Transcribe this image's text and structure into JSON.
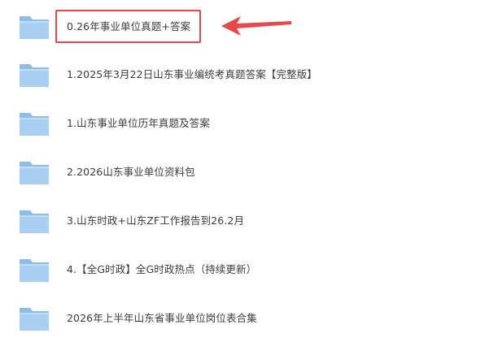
{
  "folders": [
    {
      "name": "0.26年事业单位真题+答案"
    },
    {
      "name": "1.2025年3月22日山东事业编统考真题答案【完整版】"
    },
    {
      "name": "1.山东事业单位历年真题及答案"
    },
    {
      "name": "2.2026山东事业单位资料包"
    },
    {
      "name": "3.山东时政+山东ZF工作报告到26.2月"
    },
    {
      "name": "4.【全G时政】全G时政热点（持续更新）"
    },
    {
      "name": "2026年上半年山东省事业单位岗位表合集"
    }
  ],
  "icons": {
    "folder": "folder-icon",
    "annotation": "arrow-left-icon"
  },
  "colors": {
    "folder_back": "#8dbde6",
    "folder_front": "#a9d0f2",
    "highlight": "#e8484a",
    "text": "#3b3b3b"
  }
}
